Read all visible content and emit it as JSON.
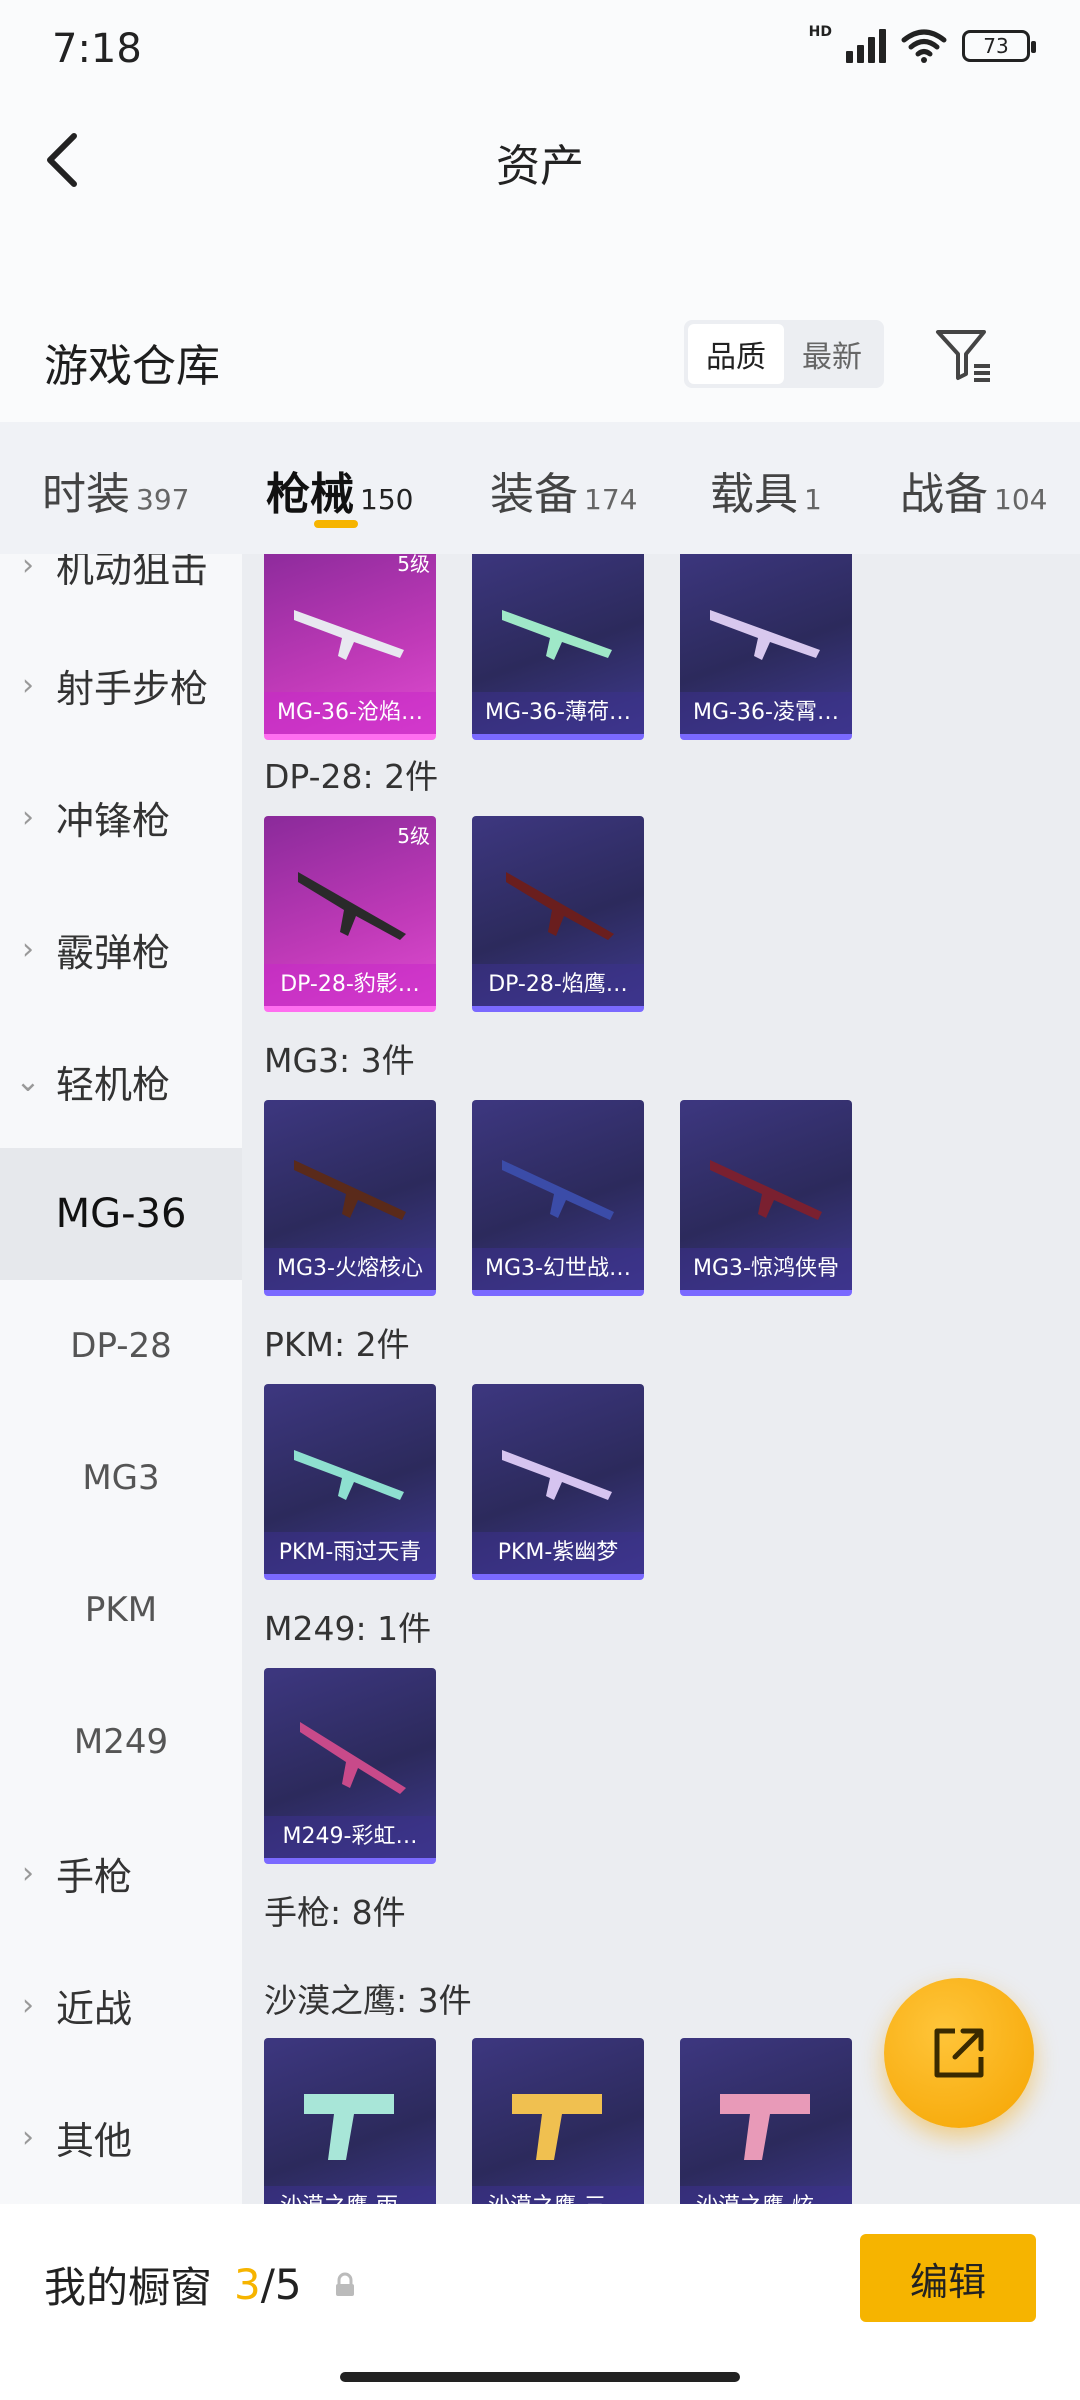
{
  "status": {
    "time": "7:18",
    "battery": "73",
    "network": "HD"
  },
  "nav": {
    "title": "资产"
  },
  "header": {
    "title": "游戏仓库",
    "sort_quality": "品质",
    "sort_newest": "最新"
  },
  "tabs": [
    {
      "label": "时装",
      "count": "397"
    },
    {
      "label": "枪械",
      "count": "150"
    },
    {
      "label": "装备",
      "count": "174"
    },
    {
      "label": "载具",
      "count": "1"
    },
    {
      "label": "战备",
      "count": "104"
    }
  ],
  "sidebar": {
    "categories": [
      "机动狙击",
      "射手步枪",
      "冲锋枪",
      "霰弹枪",
      "轻机枪",
      "手枪",
      "近战",
      "其他"
    ],
    "subs": [
      "MG-36",
      "DP-28",
      "MG3",
      "PKM",
      "M249"
    ]
  },
  "groups": {
    "mg36": {
      "items": [
        {
          "name": "MG-36-沧焰…",
          "level": "5级"
        },
        {
          "name": "MG-36-薄荷…"
        },
        {
          "name": "MG-36-凌霄…"
        }
      ]
    },
    "dp28": {
      "title": "DP-28: 2件",
      "items": [
        {
          "name": "DP-28-豹影…",
          "level": "5级"
        },
        {
          "name": "DP-28-焰鹰…"
        }
      ]
    },
    "mg3": {
      "title": "MG3: 3件",
      "items": [
        {
          "name": "MG3-火熔核心"
        },
        {
          "name": "MG3-幻世战…"
        },
        {
          "name": "MG3-惊鸿侠骨"
        }
      ]
    },
    "pkm": {
      "title": "PKM: 2件",
      "items": [
        {
          "name": "PKM-雨过天青"
        },
        {
          "name": "PKM-紫幽梦"
        }
      ]
    },
    "m249": {
      "title": "M249: 1件",
      "items": [
        {
          "name": "M249-彩虹…"
        }
      ]
    },
    "pistol": {
      "title": "手枪: 8件"
    },
    "deagle": {
      "title": "沙漠之鹰: 3件",
      "items": [
        {
          "name": "沙漠之鹰-雨…"
        },
        {
          "name": "沙漠之鹰-三…"
        },
        {
          "name": "沙漠之鹰-炫…"
        }
      ]
    }
  },
  "bottom": {
    "label": "我的橱窗",
    "used": "3",
    "slash": "/",
    "total": "5",
    "edit": "编辑"
  },
  "colors": {
    "accent": "#f6b400",
    "epic": "#3d3780",
    "legendary": "#c03ab8"
  }
}
